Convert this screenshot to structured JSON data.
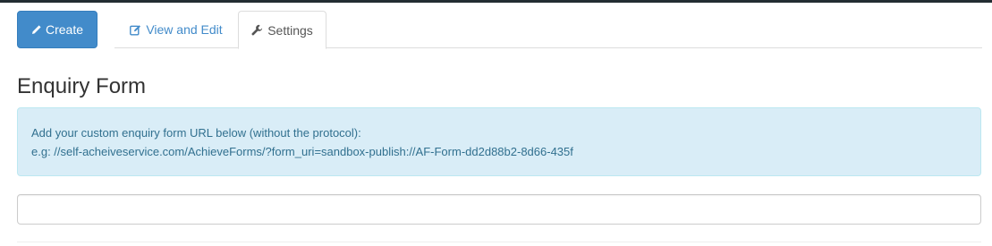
{
  "tabs": {
    "create_label": "Create",
    "view_edit_label": "View and Edit",
    "settings_label": "Settings",
    "active": "Settings"
  },
  "icons": {
    "create": "pencil-icon",
    "view_edit": "edit-icon",
    "settings": "wrench-icon"
  },
  "section": {
    "title": "Enquiry Form"
  },
  "info": {
    "line1": "Add your custom enquiry form URL below (without the protocol):",
    "line2": "e.g: //self-acheiveservice.com/AchieveForms/?form_uri=sandbox-publish://AF-Form-dd2d88b2-8d66-435f"
  },
  "form": {
    "url_value": ""
  },
  "colors": {
    "primary": "#428bca",
    "info_bg": "#d9edf7",
    "info_text": "#31708f",
    "topbar": "#222d32"
  }
}
